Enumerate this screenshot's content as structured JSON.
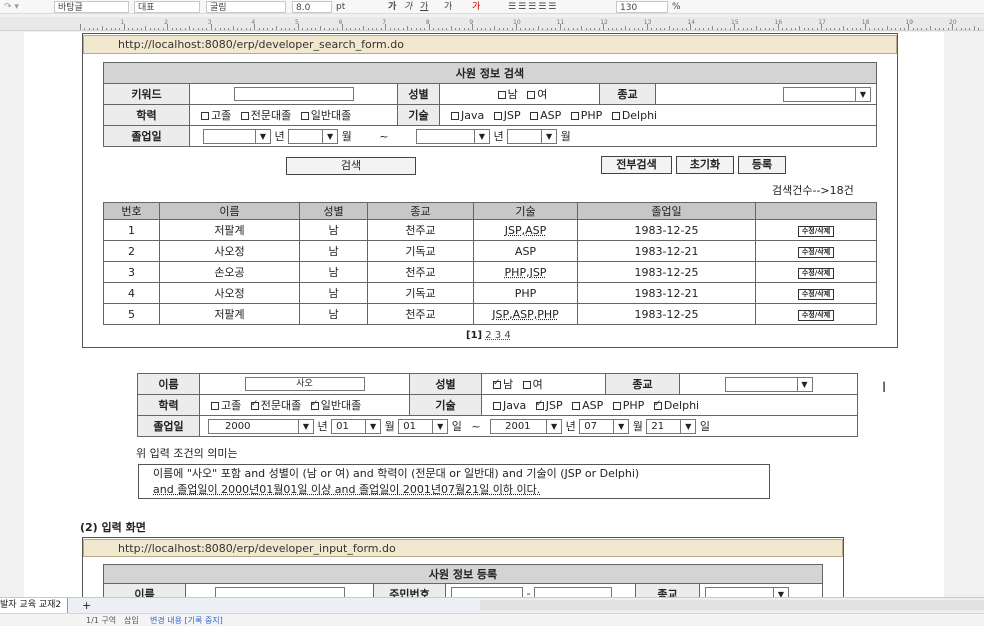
{
  "toolbar": {
    "style": "바탕글",
    "para": "대표",
    "font": "굴림",
    "size": "8.0",
    "unit": "pt",
    "zoom": "130",
    "zoom_unit": "%",
    "bold": "가",
    "italic": "가",
    "under": "가",
    "font_size_btn": "가",
    "color_btn": "가"
  },
  "ruler": {
    "numbers": [
      "1",
      "2",
      "3",
      "4",
      "5",
      "6",
      "7",
      "8",
      "9",
      "10",
      "11",
      "12",
      "13",
      "14",
      "15",
      "16",
      "17",
      "18",
      "19",
      "20"
    ]
  },
  "search": {
    "url": "http://localhost:8080/erp/developer_search_form.do",
    "title": "사원 정보 검색",
    "keyword_label": "키워드",
    "gender_label": "성별",
    "gender_opts": [
      "남",
      "여"
    ],
    "religion_label": "종교",
    "edu_label": "학력",
    "edu_opts": [
      "고졸",
      "전문대졸",
      "일반대졸"
    ],
    "skill_label": "기술",
    "skill_opts": [
      "Java",
      "JSP",
      "ASP",
      "PHP",
      "Delphi"
    ],
    "grad_label": "졸업일",
    "year": "년",
    "month": "월",
    "tilde": "~",
    "search_btn": "검색",
    "all_btn": "전부검색",
    "reset_btn": "초기화",
    "reg_btn": "등록",
    "count_text": "검색건수-->18건",
    "columns": [
      "번호",
      "이름",
      "성별",
      "종교",
      "기술",
      "졸업일",
      ""
    ],
    "rows": [
      [
        "1",
        "저팔계",
        "남",
        "천주교",
        "JSP,ASP",
        "1983-12-25"
      ],
      [
        "2",
        "사오정",
        "남",
        "기독교",
        "ASP",
        "1983-12-21"
      ],
      [
        "3",
        "손오공",
        "남",
        "천주교",
        "PHP,JSP",
        "1983-12-25"
      ],
      [
        "4",
        "사오정",
        "남",
        "기독교",
        "PHP",
        "1983-12-21"
      ],
      [
        "5",
        "저팔계",
        "남",
        "천주교",
        "JSP,ASP,PHP",
        "1983-12-25"
      ]
    ],
    "row_action": "수정/삭제",
    "pager_current": "[1]",
    "pager": "2 3 4"
  },
  "example": {
    "name_label": "이름",
    "name_value": "사오",
    "gender_label": "성별",
    "gender_opts": [
      "남",
      "여"
    ],
    "religion_label": "종교",
    "edu_label": "학력",
    "edu_opts": [
      "고졸",
      "전문대졸",
      "일반대졸"
    ],
    "skill_label": "기술",
    "skill_opts": [
      "Java",
      "JSP",
      "ASP",
      "PHP",
      "Delphi"
    ],
    "grad_label": "졸업일",
    "y1": "2000",
    "m1": "01",
    "d1": "01",
    "y2": "2001",
    "m2": "07",
    "d2": "21",
    "year": "년",
    "month": "월",
    "day": "일",
    "tilde": "~",
    "meaning_title": "위 입력 조건의 의미는",
    "meaning_line1": "이름에 \"사오\" 포함 and 성별이 (남 or 여) and 학력이 (전문대 or 일반대) and 기술이 (JSP   or Delphi)",
    "meaning_line2": "and 졸업일이 2000년01월01일 이상 and 졸업일이 2001년07월21일 이하 이다."
  },
  "input": {
    "section_title": "(2) 입력 화면",
    "url": "http://localhost:8080/erp/developer_input_form.do",
    "title": "사원 정보 등록",
    "name_label": "이름",
    "ssn_label": "주민번호",
    "dash": "-",
    "religion_label": "종교"
  },
  "tabs": {
    "doc_tab": "발자 교육 교재2",
    "add": "+"
  },
  "status": {
    "line": "1/1 구역",
    "insert": "삽입",
    "change": "변경 내용 [기록 중지]"
  }
}
